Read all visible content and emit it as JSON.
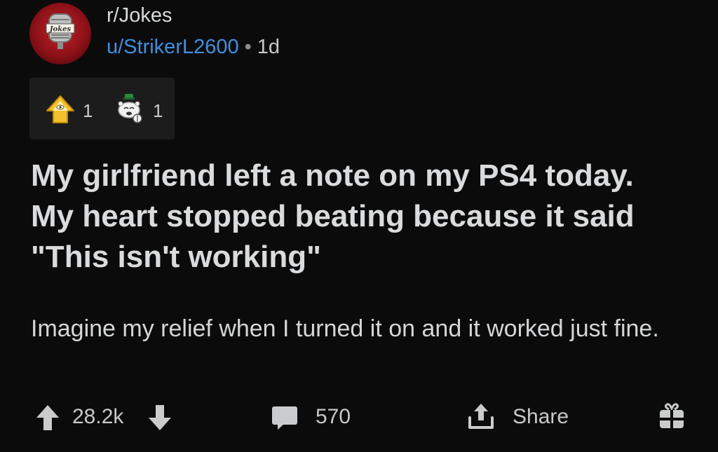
{
  "header": {
    "subreddit": "r/Jokes",
    "avatar_label": "Jokes",
    "author": "u/StrikerL2600",
    "separator": "•",
    "age": "1d"
  },
  "awards": [
    {
      "icon": "illuminati-award-icon",
      "count": "1"
    },
    {
      "icon": "snoo-award-icon",
      "count": "1"
    }
  ],
  "post": {
    "title": "My girlfriend left a note on my PS4 today. My heart stopped beating because it said \"This isn't working\"",
    "body": "Imagine my relief when I turned it on and it worked just fine."
  },
  "actions": {
    "score": "28.2k",
    "comments": "570",
    "share_label": "Share"
  },
  "colors": {
    "background": "#0b0b0b",
    "author_link": "#3f8fe0",
    "award_panel": "#1c1c1c"
  }
}
